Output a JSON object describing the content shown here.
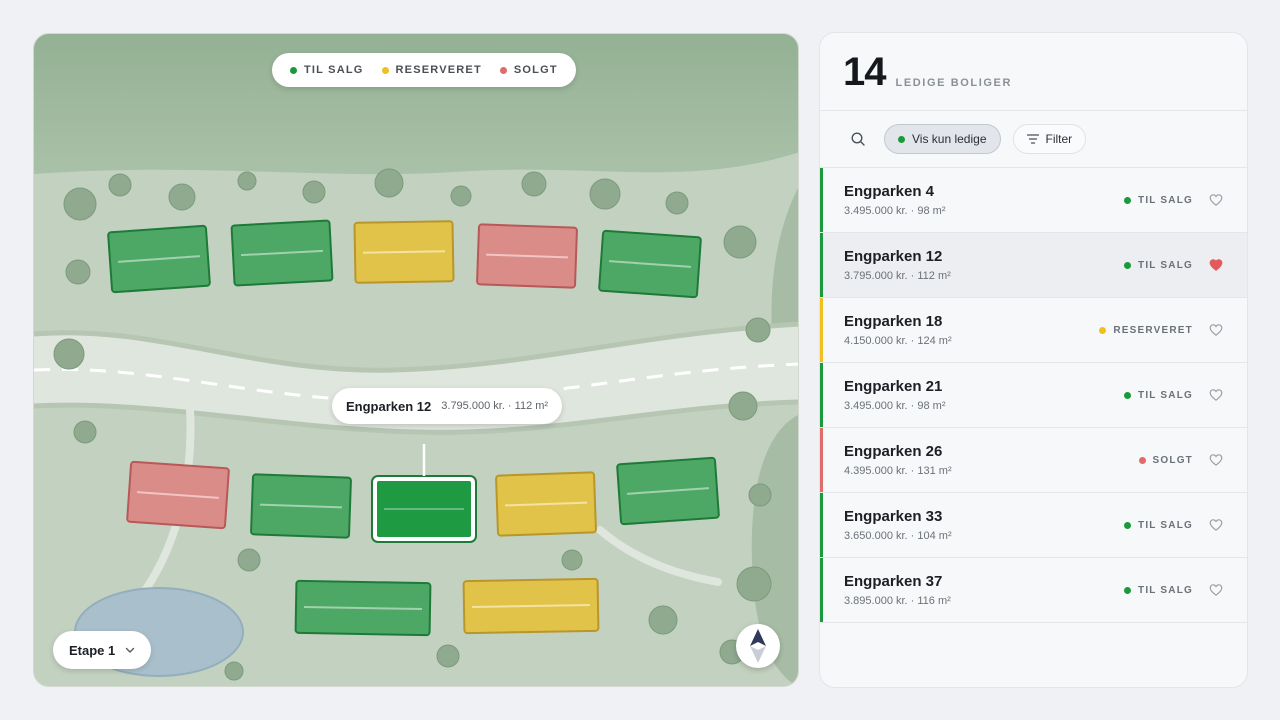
{
  "colors": {
    "til_salg": "#1a9a3c",
    "reserveret": "#f0c020",
    "solgt": "#e06b6b",
    "heart_active": "#e25a5a"
  },
  "legend": [
    {
      "label": "TIL SALG",
      "color": "#1a9a3c"
    },
    {
      "label": "RESERVERET",
      "color": "#f0c020"
    },
    {
      "label": "SOLGT",
      "color": "#e06b6b"
    }
  ],
  "tooltip": {
    "name": "Engparken 12",
    "meta": "3.795.000 kr. · 112 m²"
  },
  "stage": {
    "label": "Etape 1",
    "icon": "chevron-down-icon"
  },
  "compass": {
    "icon": "compass-icon"
  },
  "panel": {
    "count": "14",
    "count_label": "LEDIGE BOLIGER",
    "search_icon": "search-icon",
    "chip_available": "Vis kun ledige",
    "chip_filter": "Filter",
    "filter_icon": "filter-icon"
  },
  "listings": [
    {
      "name": "Engparken 4",
      "meta": "3.495.000 kr. · 98 m²",
      "status": "TIL SALG",
      "status_color": "#1a9a3c",
      "favorite": false,
      "selected": false
    },
    {
      "name": "Engparken 12",
      "meta": "3.795.000 kr. · 112 m²",
      "status": "TIL SALG",
      "status_color": "#1a9a3c",
      "favorite": true,
      "selected": true
    },
    {
      "name": "Engparken 18",
      "meta": "4.150.000 kr. · 124 m²",
      "status": "RESERVERET",
      "status_color": "#f0c020",
      "favorite": false,
      "selected": false
    },
    {
      "name": "Engparken 21",
      "meta": "3.495.000 kr. · 98 m²",
      "status": "TIL SALG",
      "status_color": "#1a9a3c",
      "favorite": false,
      "selected": false
    },
    {
      "name": "Engparken 26",
      "meta": "4.395.000 kr. · 131 m²",
      "status": "SOLGT",
      "status_color": "#e06b6b",
      "favorite": false,
      "selected": false
    },
    {
      "name": "Engparken 33",
      "meta": "3.650.000 kr. · 104 m²",
      "status": "TIL SALG",
      "status_color": "#1a9a3c",
      "favorite": false,
      "selected": false
    },
    {
      "name": "Engparken 37",
      "meta": "3.895.000 kr. · 116 m²",
      "status": "TIL SALG",
      "status_color": "#1a9a3c",
      "favorite": false,
      "selected": false
    }
  ]
}
